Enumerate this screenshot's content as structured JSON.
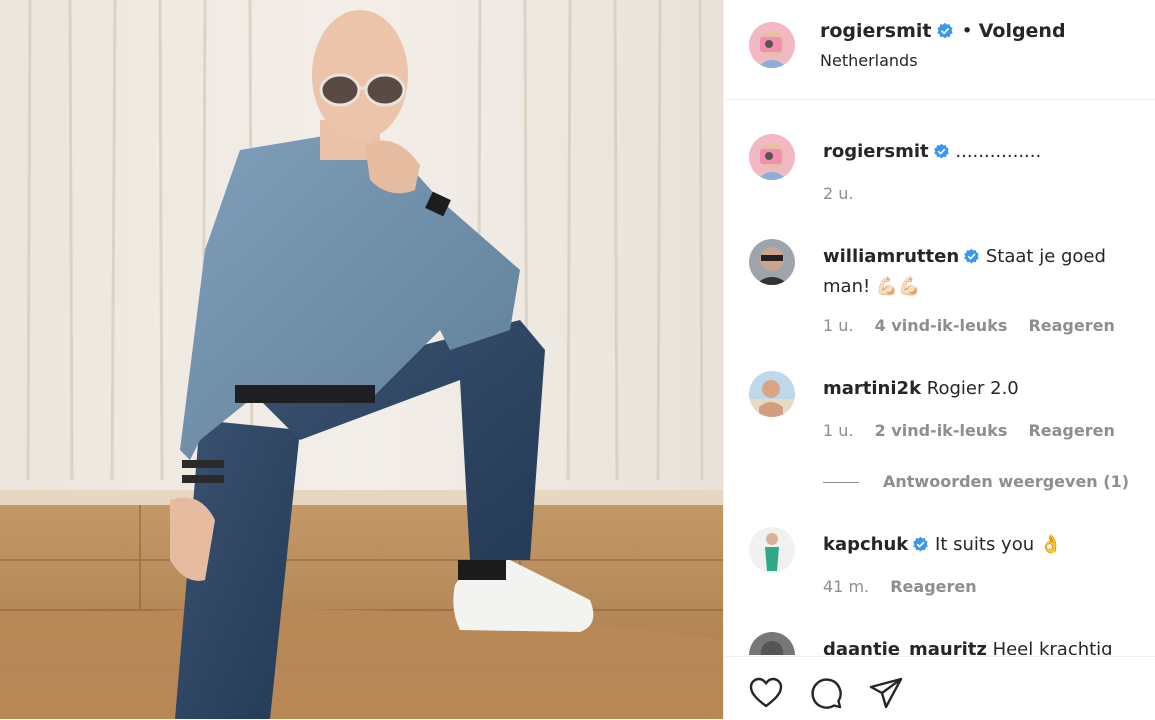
{
  "header": {
    "username": "rogiersmit",
    "follow_label": "Volgend",
    "separator": "•",
    "location": "Netherlands"
  },
  "comments": [
    {
      "username": "rogiersmit",
      "verified": true,
      "text": "...............",
      "time": "2 u.",
      "likes": "",
      "reply": ""
    },
    {
      "username": "williamrutten",
      "verified": true,
      "text": "Staat je goed man! 💪🏻💪🏻",
      "time": "1 u.",
      "likes": "4 vind-ik-leuks",
      "reply": "Reageren"
    },
    {
      "username": "martini2k",
      "verified": false,
      "text": "Rogier 2.0",
      "time": "1 u.",
      "likes": "2 vind-ik-leuks",
      "reply": "Reageren",
      "view_replies": "Antwoorden weergeven (1)"
    },
    {
      "username": "kapchuk",
      "verified": true,
      "text": "It suits you 👌",
      "time": "41 m.",
      "likes": "",
      "reply": "Reageren"
    },
    {
      "username": "daantje_mauritz",
      "verified": false,
      "text": "Heel krachtig",
      "time": "",
      "likes": "",
      "reply": ""
    }
  ],
  "actions": [
    "heart-icon",
    "comment-icon",
    "share-icon"
  ],
  "colors": {
    "verified": "#3897f0",
    "text": "#262626",
    "muted": "#8e8e8e",
    "border": "#efefef"
  }
}
